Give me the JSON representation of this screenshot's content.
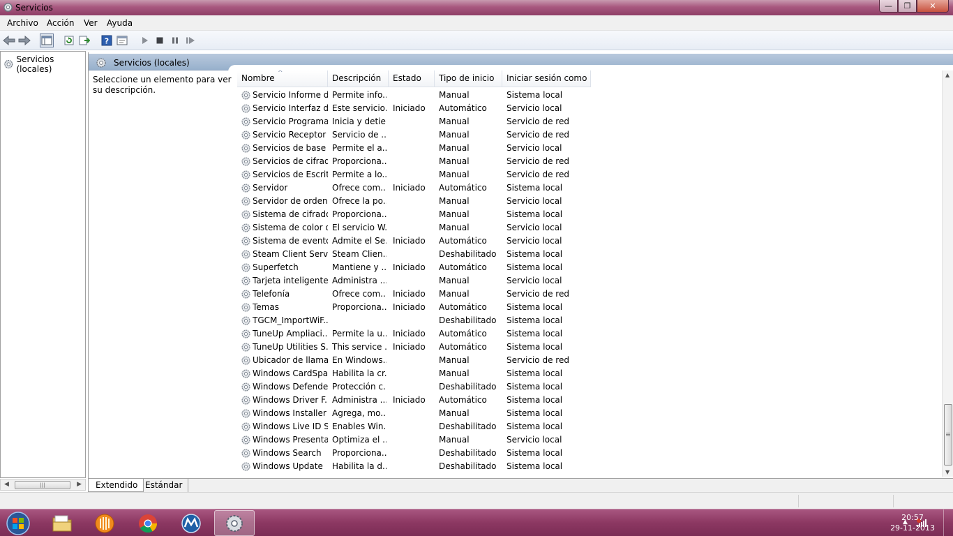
{
  "window": {
    "title": "Servicios"
  },
  "menu": [
    "Archivo",
    "Acción",
    "Ver",
    "Ayuda"
  ],
  "tree": {
    "item": "Servicios (locales)"
  },
  "pane": {
    "header": "Servicios (locales)",
    "description": "Seleccione un elemento para ver su descripción."
  },
  "columns": [
    "Nombre",
    "Descripción",
    "Estado",
    "Tipo de inicio",
    "Iniciar sesión como"
  ],
  "rows": [
    [
      "Servicio Informe d...",
      "Permite info...",
      "",
      "Manual",
      "Sistema local"
    ],
    [
      "Servicio Interfaz d...",
      "Este servicio...",
      "Iniciado",
      "Automático",
      "Servicio local"
    ],
    [
      "Servicio Programa...",
      "Inicia y detie...",
      "",
      "Manual",
      "Servicio de red"
    ],
    [
      "Servicio Receptor ...",
      "Servicio de ...",
      "",
      "Manual",
      "Servicio de red"
    ],
    [
      "Servicios de base ...",
      "Permite el a...",
      "",
      "Manual",
      "Servicio local"
    ],
    [
      "Servicios de cifrado",
      "Proporciona...",
      "",
      "Manual",
      "Servicio de red"
    ],
    [
      "Servicios de Escrit...",
      "Permite a lo...",
      "",
      "Manual",
      "Servicio de red"
    ],
    [
      "Servidor",
      "Ofrece com...",
      "Iniciado",
      "Automático",
      "Sistema local"
    ],
    [
      "Servidor de orden ...",
      "Ofrece la po...",
      "",
      "Manual",
      "Servicio local"
    ],
    [
      "Sistema de cifrado...",
      "Proporciona...",
      "",
      "Manual",
      "Sistema local"
    ],
    [
      "Sistema de color d...",
      "El servicio W...",
      "",
      "Manual",
      "Servicio local"
    ],
    [
      "Sistema de evento...",
      "Admite el Se...",
      "Iniciado",
      "Automático",
      "Servicio local"
    ],
    [
      "Steam Client Servi...",
      "Steam Clien...",
      "",
      "Deshabilitado",
      "Sistema local"
    ],
    [
      "Superfetch",
      "Mantiene y ...",
      "Iniciado",
      "Automático",
      "Sistema local"
    ],
    [
      "Tarjeta inteligente",
      "Administra ...",
      "",
      "Manual",
      "Servicio local"
    ],
    [
      "Telefonía",
      "Ofrece com...",
      "Iniciado",
      "Manual",
      "Servicio de red"
    ],
    [
      "Temas",
      "Proporciona...",
      "Iniciado",
      "Automático",
      "Sistema local"
    ],
    [
      "TGCM_ImportWiF...",
      "",
      "",
      "Deshabilitado",
      "Sistema local"
    ],
    [
      "TuneUp Ampliaci...",
      "Permite la u...",
      "Iniciado",
      "Automático",
      "Sistema local"
    ],
    [
      "TuneUp Utilities S...",
      "This service ...",
      "Iniciado",
      "Automático",
      "Sistema local"
    ],
    [
      "Ubicador de llama...",
      "En Windows...",
      "",
      "Manual",
      "Servicio de red"
    ],
    [
      "Windows CardSpa...",
      "Habilita la cr...",
      "",
      "Manual",
      "Sistema local"
    ],
    [
      "Windows Defender",
      "Protección c...",
      "",
      "Deshabilitado",
      "Sistema local"
    ],
    [
      "Windows Driver F...",
      "Administra ...",
      "Iniciado",
      "Automático",
      "Sistema local"
    ],
    [
      "Windows Installer",
      "Agrega, mo...",
      "",
      "Manual",
      "Sistema local"
    ],
    [
      "Windows Live ID S...",
      "Enables Win...",
      "",
      "Deshabilitado",
      "Sistema local"
    ],
    [
      "Windows Presenta...",
      "Optimiza el ...",
      "",
      "Manual",
      "Servicio local"
    ],
    [
      "Windows Search",
      "Proporciona...",
      "",
      "Deshabilitado",
      "Sistema local"
    ],
    [
      "Windows Update",
      "Habilita la d...",
      "",
      "Deshabilitado",
      "Sistema local"
    ]
  ],
  "tabs": [
    "Extendido",
    "Estándar"
  ],
  "taskbar": {
    "apps": [
      "explorer-icon",
      "media-player-icon",
      "chrome-icon",
      "metro-app-icon",
      "services-icon"
    ],
    "clock": {
      "time": "20:57",
      "date": "29-11-2013"
    }
  },
  "colors": {
    "title": "#a8587f",
    "taskbar": "#8c3862",
    "header": "#a9bdd5"
  }
}
